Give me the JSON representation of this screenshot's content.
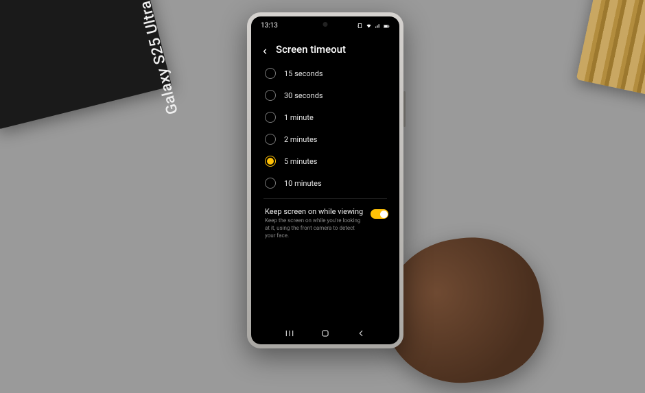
{
  "product_box": {
    "label": "Galaxy S25 Ultra"
  },
  "status": {
    "time": "13:13"
  },
  "header": {
    "title": "Screen timeout"
  },
  "options": [
    {
      "label": "15 seconds",
      "selected": false
    },
    {
      "label": "30 seconds",
      "selected": false
    },
    {
      "label": "1 minute",
      "selected": false
    },
    {
      "label": "2 minutes",
      "selected": false
    },
    {
      "label": "5 minutes",
      "selected": true
    },
    {
      "label": "10 minutes",
      "selected": false
    }
  ],
  "toggle": {
    "title": "Keep screen on while viewing",
    "desc": "Keep the screen on while you're looking at it, using the front camera to detect your face.",
    "on": true
  }
}
